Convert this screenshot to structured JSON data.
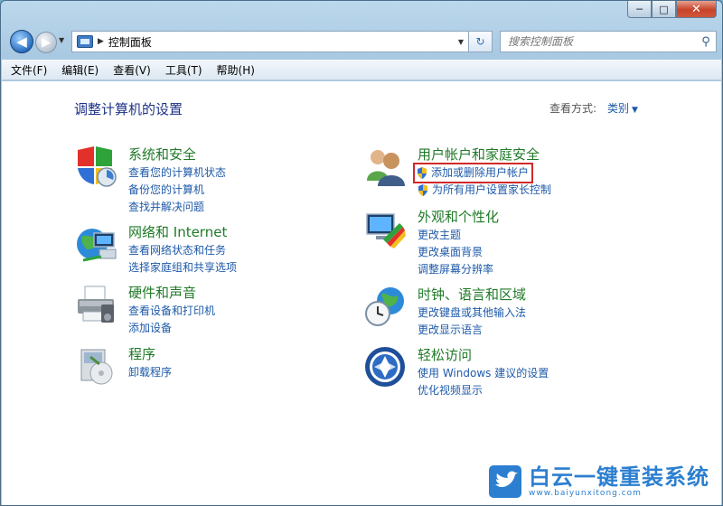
{
  "window": {
    "caption": {
      "minimize": "─",
      "maximize": "□",
      "close": "✕"
    }
  },
  "nav": {
    "back": "◀",
    "forward": "▶",
    "address_arrow": "▶",
    "address_text": "控制面板",
    "address_drop": "▼",
    "refresh": "↻",
    "search_placeholder": "搜索控制面板",
    "search_icon": "⚲"
  },
  "menubar": [
    "文件(F)",
    "编辑(E)",
    "查看(V)",
    "工具(T)",
    "帮助(H)"
  ],
  "content": {
    "title": "调整计算机的设置",
    "view_label": "查看方式:",
    "view_value": "类别",
    "view_caret": "▼",
    "left": [
      {
        "heading": "系统和安全",
        "icon": "shield-security-icon",
        "links": [
          "查看您的计算机状态",
          "备份您的计算机",
          "查找并解决问题"
        ]
      },
      {
        "heading": "网络和 Internet",
        "icon": "network-globe-icon",
        "links": [
          "查看网络状态和任务",
          "选择家庭组和共享选项"
        ]
      },
      {
        "heading": "硬件和声音",
        "icon": "printer-icon",
        "links": [
          "查看设备和打印机",
          "添加设备"
        ]
      },
      {
        "heading": "程序",
        "icon": "programs-box-icon",
        "links": [
          "卸载程序"
        ]
      }
    ],
    "right": [
      {
        "heading": "用户帐户和家庭安全",
        "icon": "users-icon",
        "links": [
          "添加或删除用户帐户",
          "为所有用户设置家长控制"
        ]
      },
      {
        "heading": "外观和个性化",
        "icon": "monitor-palette-icon",
        "links": [
          "更改主题",
          "更改桌面背景",
          "调整屏幕分辨率"
        ]
      },
      {
        "heading": "时钟、语言和区域",
        "icon": "clock-globe-icon",
        "links": [
          "更改键盘或其他输入法",
          "更改显示语言"
        ]
      },
      {
        "heading": "轻松访问",
        "icon": "ease-of-access-icon",
        "links": [
          "使用 Windows 建议的设置",
          "优化视频显示"
        ]
      }
    ]
  },
  "watermark": {
    "title": "白云一键重装系统",
    "url": "www.baiyunxitong.com"
  },
  "colors": {
    "heading": "#1f7a27",
    "link": "#1e5aa8",
    "title": "#1e3287",
    "highlight": "#d12a2a"
  }
}
